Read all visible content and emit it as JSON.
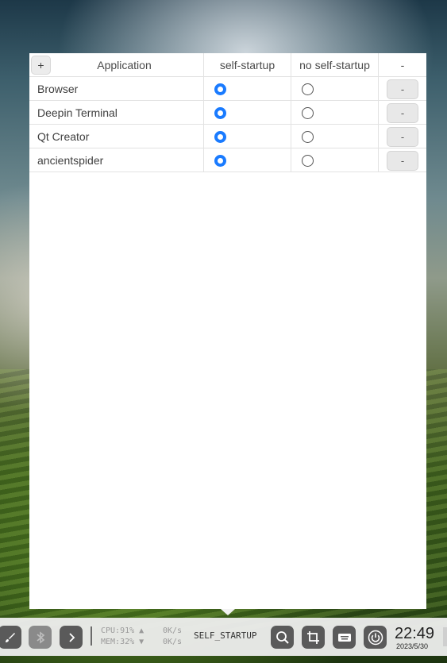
{
  "table": {
    "add_label": "+",
    "headers": {
      "application": "Application",
      "self_startup": "self-startup",
      "no_self_startup": "no self-startup",
      "action": "-"
    },
    "rows": [
      {
        "name": "Browser",
        "self_startup": true,
        "delete_label": "-"
      },
      {
        "name": "Deepin Terminal",
        "self_startup": true,
        "delete_label": "-"
      },
      {
        "name": "Qt Creator",
        "self_startup": true,
        "delete_label": "-"
      },
      {
        "name": "ancientspider",
        "self_startup": true,
        "delete_label": "-"
      }
    ]
  },
  "taskbar": {
    "cpu": "CPU:91% ▲",
    "mem": "MEM:32% ▼",
    "net_up": "0K/s",
    "net_down": "0K/s",
    "app_name": "SELF_STARTUP",
    "time": "22:49",
    "date": "2023/5/30",
    "icons": [
      "brush-icon",
      "bluetooth-icon",
      "chevron-right-icon",
      "search-icon",
      "screenshot-icon",
      "keyboard-icon",
      "power-icon"
    ]
  },
  "colors": {
    "radio_selected": "#1a7bff"
  }
}
